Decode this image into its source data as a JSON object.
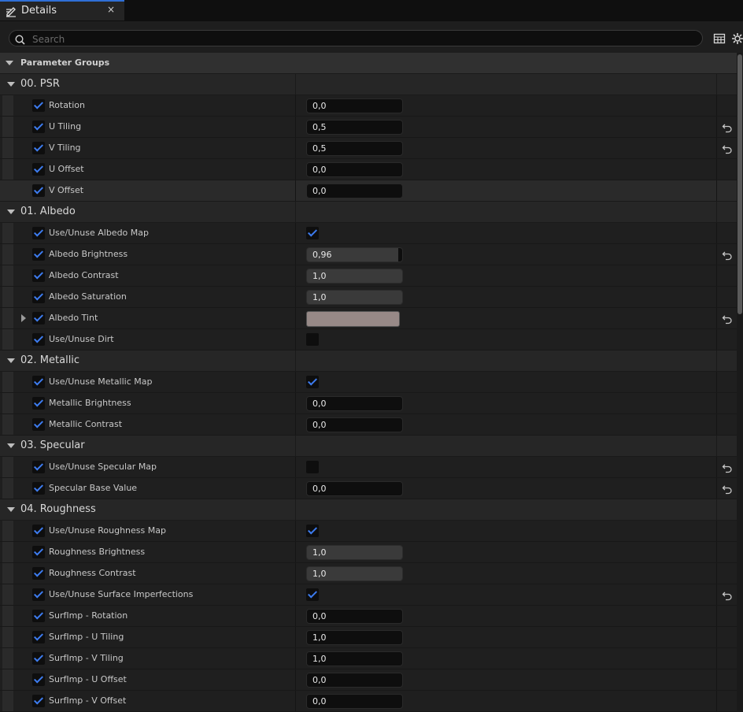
{
  "tab": {
    "title": "Details",
    "close": "×"
  },
  "search": {
    "placeholder": "Search",
    "value": ""
  },
  "toolbar": {
    "icons": [
      "table-view-icon",
      "settings-gear-icon"
    ]
  },
  "param_groups_label": "Parameter Groups",
  "colors": {
    "accent": "#3d7cf0",
    "albedo_tint": "#978987"
  },
  "groups": [
    {
      "label": "00. PSR",
      "rows": [
        {
          "name": "Rotation",
          "type": "number",
          "value": "0,0",
          "reset": false
        },
        {
          "name": "U Tiling",
          "type": "number",
          "value": "0,5",
          "reset": true
        },
        {
          "name": "V Tiling",
          "type": "number",
          "value": "0,5",
          "reset": true
        },
        {
          "name": "U Offset",
          "type": "number",
          "value": "0,0",
          "reset": false
        },
        {
          "name": "V Offset",
          "type": "number",
          "value": "0,0",
          "reset": false,
          "highlighted": true
        }
      ]
    },
    {
      "label": "01. Albedo",
      "rows": [
        {
          "name": "Use/Unuse Albedo Map",
          "type": "bool",
          "checked": true,
          "reset": false
        },
        {
          "name": "Albedo Brightness",
          "type": "slider",
          "value": "0,96",
          "fraction": 0.96,
          "reset": true
        },
        {
          "name": "Albedo Contrast",
          "type": "slider",
          "value": "1,0",
          "fraction": 1.0,
          "reset": false
        },
        {
          "name": "Albedo Saturation",
          "type": "slider",
          "value": "1,0",
          "fraction": 1.0,
          "reset": false
        },
        {
          "name": "Albedo Tint",
          "type": "color",
          "reset": true,
          "expandable": true
        },
        {
          "name": "Use/Unuse Dirt",
          "type": "bool",
          "checked": false,
          "reset": false
        }
      ]
    },
    {
      "label": "02. Metallic",
      "rows": [
        {
          "name": "Use/Unuse Metallic Map",
          "type": "bool",
          "checked": true,
          "reset": false
        },
        {
          "name": "Metallic Brightness",
          "type": "number",
          "value": "0,0",
          "reset": false
        },
        {
          "name": "Metallic Contrast",
          "type": "number",
          "value": "0,0",
          "reset": false
        }
      ]
    },
    {
      "label": "03. Specular",
      "rows": [
        {
          "name": "Use/Unuse Specular Map",
          "type": "bool",
          "checked": false,
          "reset": true
        },
        {
          "name": "Specular Base Value",
          "type": "number",
          "value": "0,0",
          "reset": true
        }
      ]
    },
    {
      "label": "04. Roughness",
      "rows": [
        {
          "name": "Use/Unuse Roughness Map",
          "type": "bool",
          "checked": true,
          "reset": false
        },
        {
          "name": "Roughness Brightness",
          "type": "slider",
          "value": "1,0",
          "fraction": 1.0,
          "reset": false
        },
        {
          "name": "Roughness Contrast",
          "type": "slider",
          "value": "1,0",
          "fraction": 1.0,
          "reset": false
        },
        {
          "name": "Use/Unuse Surface Imperfections",
          "type": "bool",
          "checked": true,
          "reset": true
        },
        {
          "name": "SurfImp - Rotation",
          "type": "number",
          "value": "0,0",
          "reset": false
        },
        {
          "name": "SurfImp - U Tiling",
          "type": "number",
          "value": "1,0",
          "reset": false
        },
        {
          "name": "SurfImp - V Tiling",
          "type": "number",
          "value": "1,0",
          "reset": false
        },
        {
          "name": "SurfImp - U Offset",
          "type": "number",
          "value": "0,0",
          "reset": false
        },
        {
          "name": "SurfImp - V Offset",
          "type": "number",
          "value": "0,0",
          "reset": false
        }
      ]
    }
  ]
}
